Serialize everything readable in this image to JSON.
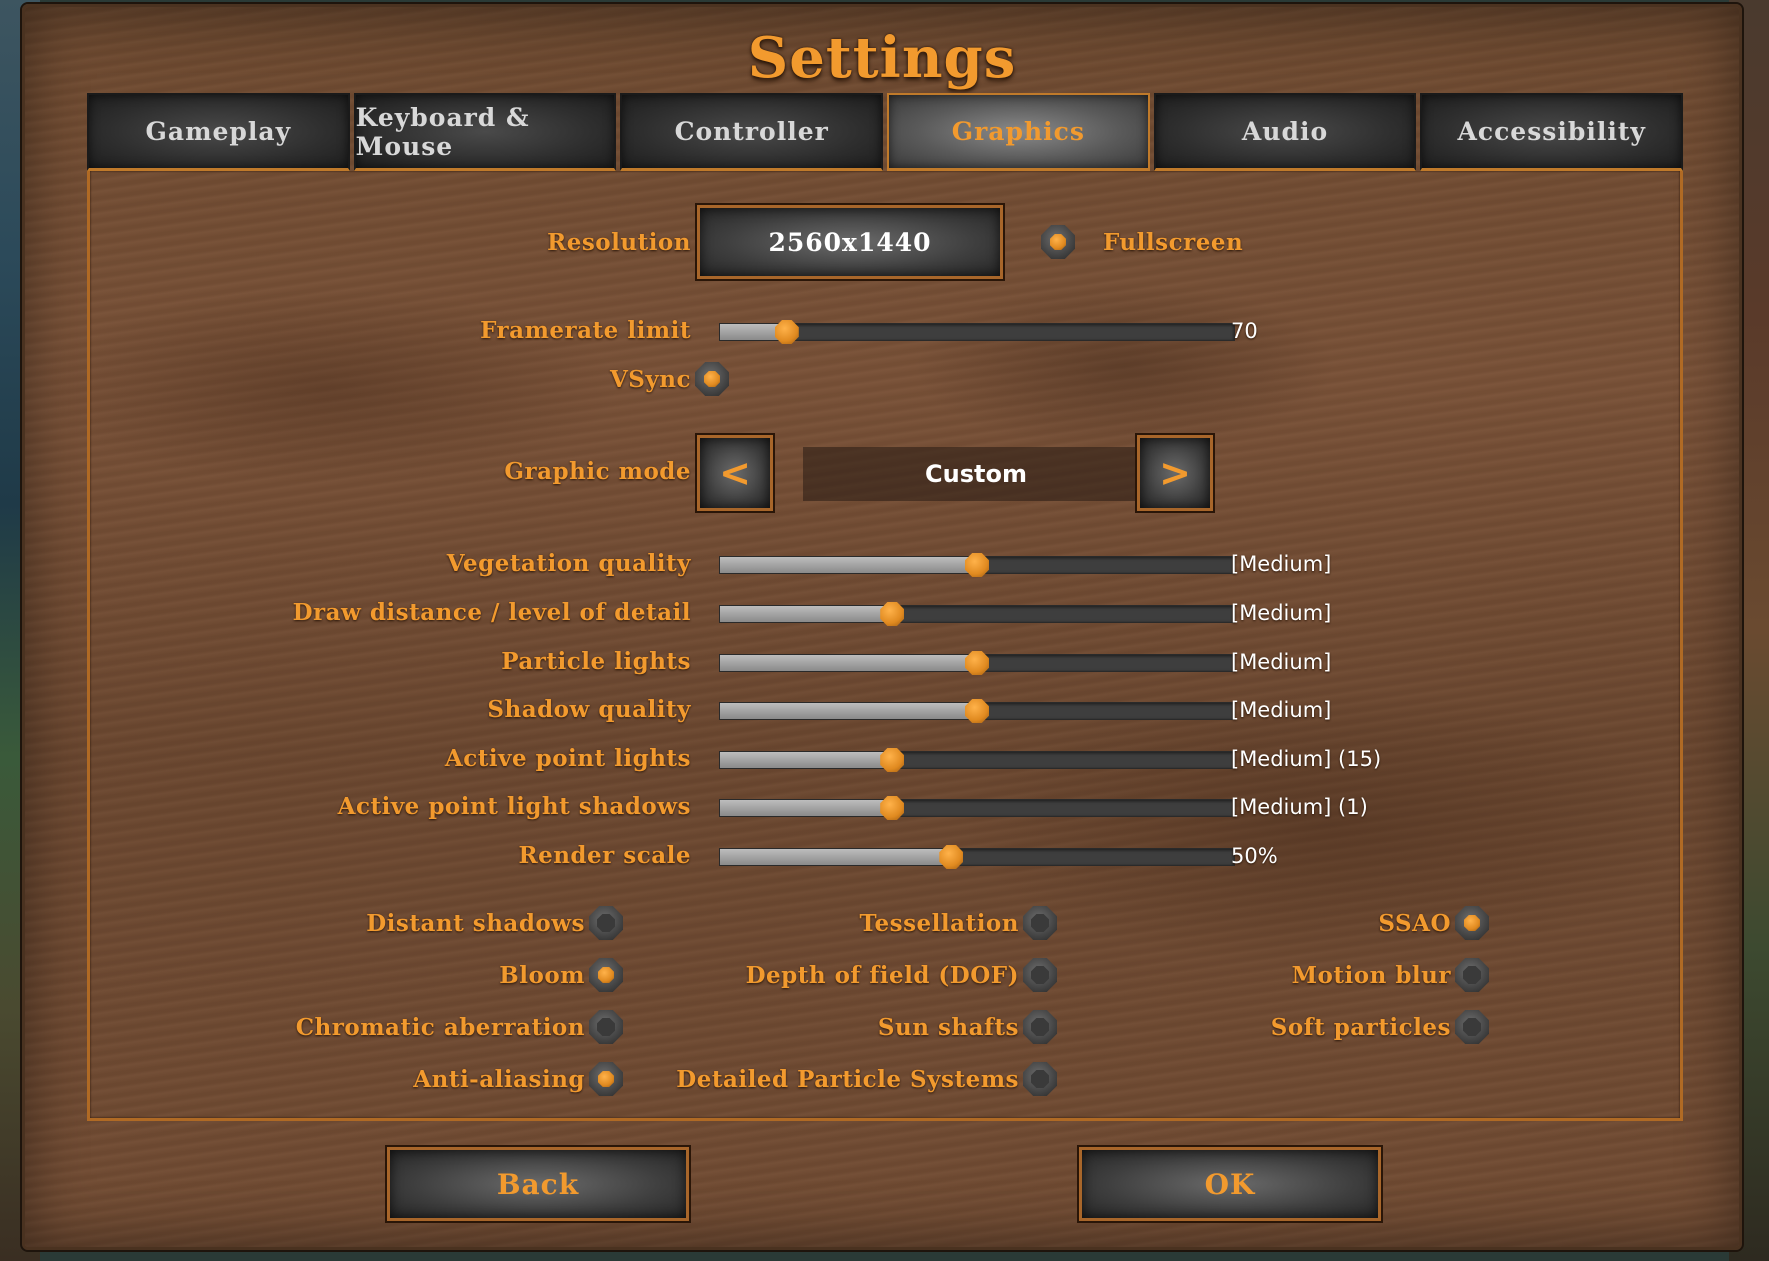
{
  "title": "Settings",
  "tabs": [
    {
      "label": "Gameplay",
      "active": false
    },
    {
      "label": "Keyboard & Mouse",
      "active": false
    },
    {
      "label": "Controller",
      "active": false
    },
    {
      "label": "Graphics",
      "active": true
    },
    {
      "label": "Audio",
      "active": false
    },
    {
      "label": "Accessibility",
      "active": false
    }
  ],
  "resolution": {
    "label": "Resolution",
    "value": "2560x1440"
  },
  "fullscreen": {
    "label": "Fullscreen",
    "on": true
  },
  "framerate": {
    "label": "Framerate limit",
    "value": "70",
    "fraction": 0.13
  },
  "vsync": {
    "label": "VSync",
    "on": true
  },
  "graphic_mode": {
    "label": "Graphic mode",
    "value": "Custom",
    "prev": "<",
    "next": ">"
  },
  "quality_sliders": [
    {
      "label": "Vegetation quality",
      "value": "[Medium]",
      "fraction": 0.5
    },
    {
      "label": "Draw distance / level of detail",
      "value": "[Medium]",
      "fraction": 0.335
    },
    {
      "label": "Particle lights",
      "value": "[Medium]",
      "fraction": 0.5
    },
    {
      "label": "Shadow quality",
      "value": "[Medium]",
      "fraction": 0.5
    },
    {
      "label": "Active point lights",
      "value": "[Medium] (15)",
      "fraction": 0.335
    },
    {
      "label": "Active point light shadows",
      "value": "[Medium] (1)",
      "fraction": 0.335
    },
    {
      "label": "Render scale",
      "value": "50%",
      "fraction": 0.45
    }
  ],
  "toggles": [
    [
      {
        "label": "Distant shadows",
        "on": false
      },
      {
        "label": "Bloom",
        "on": true
      },
      {
        "label": "Chromatic aberration",
        "on": false
      },
      {
        "label": "Anti-aliasing",
        "on": true
      }
    ],
    [
      {
        "label": "Tessellation",
        "on": false
      },
      {
        "label": "Depth of field (DOF)",
        "on": false
      },
      {
        "label": "Sun shafts",
        "on": false
      },
      {
        "label": "Detailed Particle Systems",
        "on": false
      }
    ],
    [
      {
        "label": "SSAO",
        "on": true
      },
      {
        "label": "Motion blur",
        "on": false
      },
      {
        "label": "Soft particles",
        "on": false
      }
    ]
  ],
  "buttons": {
    "back": "Back",
    "ok": "OK"
  },
  "colors": {
    "accent": "#f29a2e",
    "wood": "#704b32",
    "stone": "#3e3e3e",
    "value_text": "#ffffff"
  }
}
